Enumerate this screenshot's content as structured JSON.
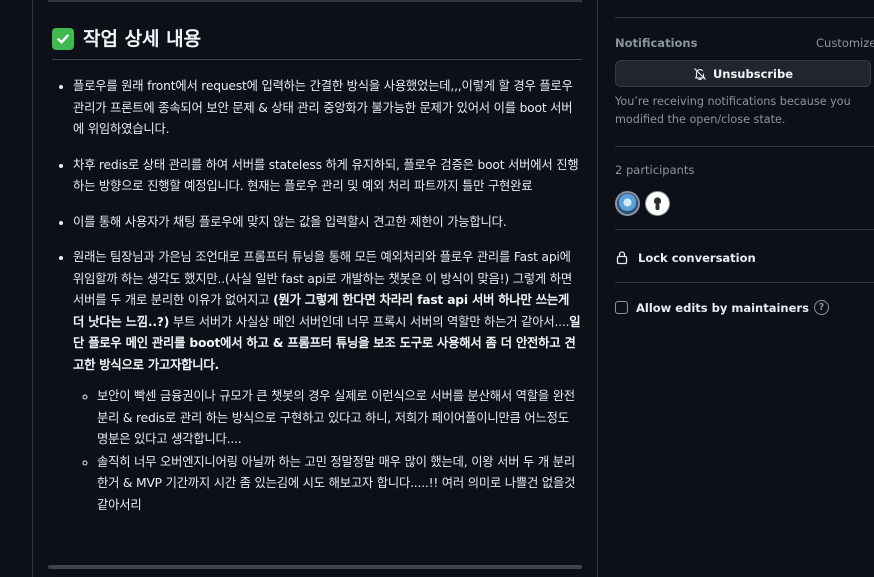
{
  "comment": {
    "heading_emoji": "check-mark-button",
    "heading": "작업 상세 내용",
    "bullets": [
      {
        "text": "플로우를 원래 front에서 request에 입력하는 간결한 방식을 사용했었는데,,,이렇게 할 경우 플로우 관리가 프론트에 종속되어 보안 문제 & 상태 관리 중앙화가 불가능한 문제가 있어서 이를 boot 서버에 위임하였습니다."
      },
      {
        "text": "차후 redis로 상태 관리를 하여 서버를 stateless 하게 유지하되, 플로우 검증은 boot 서버에서 진행하는 방향으로 진행할 예정입니다. 현재는 플로우 관리 및 예외 처리 파트까지 틀만 구현완료"
      },
      {
        "text": "이를 통해 사용자가 채팅 플로우에 맞지 않는 값을 입력할시 견고한 제한이 가능합니다."
      },
      {
        "part1": "원래는 팀장님과 가은님 조언대로 프롬프터 튜닝을 통해 모든 예외처리와 플로우 관리를 Fast api에 위임할까 하는 생각도 했지만..(사실 일반 fast api로 개발하는 챗봇은 이 방식이 맞음!) 그렇게 하면 서버를 두 개로 분리한 이유가 없어지고 ",
        "bold1": "(뭔가 그렇게 한다면 차라리 fast api 서버 하나만 쓰는게 더 낫다는 느낌..?)",
        "part2": " 부트 서버가 사실상 메인 서버인데 너무 프록시 서버의 역할만 하는거 같아서....",
        "bold2": "일단 플로우 메인 관리를 boot에서 하고 & 프롬프터 튜닝을 보조 도구로 사용해서 좀 더 안전하고 견고한 방식으로 가고자합니다.",
        "sub": [
          "보안이 빡센 금융권이나 규모가 큰 챗봇의 경우 실제로 이런식으로 서버를 분산해서 역할을 완전 분리 & redis로 관리 하는 방식으로 구현하고 있다고 하니, 저희가 페이어플이니만큼 어느정도 명분은 있다고 생각합니다....",
          "솔직히 너무 오버엔지니어링 아닐까 하는 고민 정말정말 매우 많이 했는데, 이왕 서버 두 개 분리한거 & MVP 기간까지 시간 좀 있는김에 시도 해보고자 합니다.....!! 여러 의미로 나쁠건 없을것 같아서리"
        ]
      }
    ]
  },
  "sidebar": {
    "notifications_label": "Notifications",
    "customize_label": "Customize",
    "unsubscribe_label": "Unsubscribe",
    "unsubscribe_icon": "bell-slash-icon",
    "notif_desc": "You’re receiving notifications because you modified the open/close state.",
    "participants_label": "2 participants",
    "lock_label": "Lock conversation",
    "allow_edits_label": "Allow edits by maintainers",
    "allow_edits_checked": false
  },
  "colors": {
    "background": "#0d1117",
    "text": "#e6edf3",
    "muted": "#8b949e",
    "check_green": "#3fb950",
    "border": "#30363d"
  }
}
